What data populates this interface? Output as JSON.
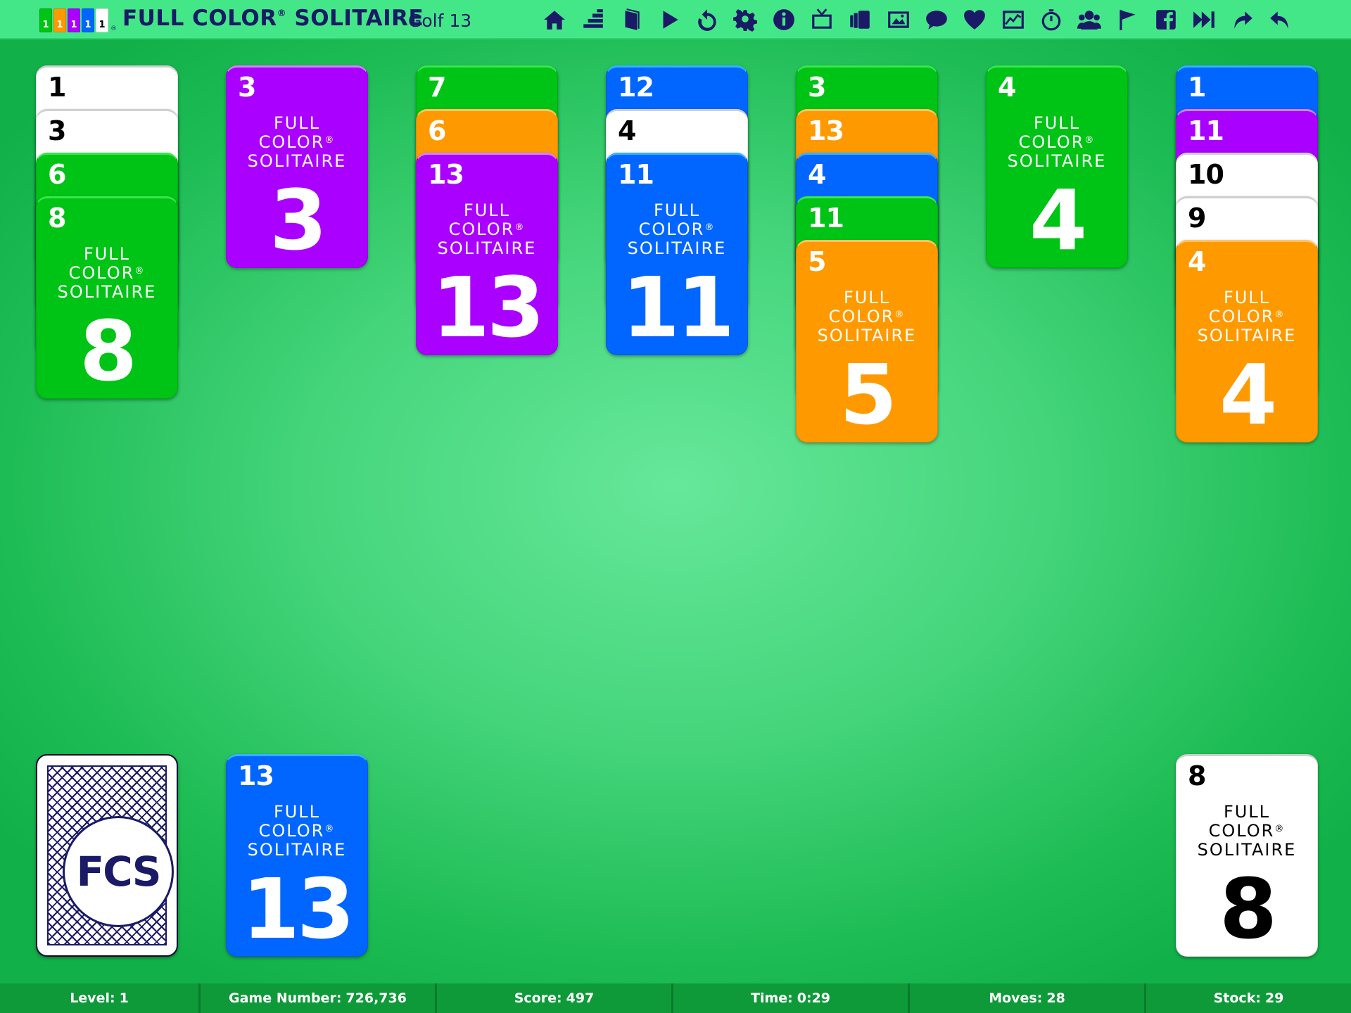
{
  "header": {
    "logo_cards": [
      {
        "label": "1",
        "color": "#00c415"
      },
      {
        "label": "1",
        "color": "#ff9900"
      },
      {
        "label": "1",
        "color": "#aa00ff"
      },
      {
        "label": "1",
        "color": "#0066ff"
      },
      {
        "label": "1",
        "color": "#ffffff"
      }
    ],
    "logo_reg": "®",
    "title": "FULL COLOR",
    "title_reg": "®",
    "title_rest": "SOLITAIRE",
    "subtitle": "Golf 13"
  },
  "toolbar": [
    "home-icon",
    "rank-icon",
    "book-icon",
    "play-icon",
    "restart-icon",
    "settings-icon",
    "info-icon",
    "tv-icon",
    "cards-icon",
    "image-icon",
    "chat-icon",
    "heart-icon",
    "stats-icon",
    "timer-icon",
    "users-icon",
    "flag-icon",
    "facebook-icon",
    "skip-forward-icon",
    "redo-icon",
    "undo-icon"
  ],
  "card_brand": {
    "line1": "FULL",
    "line2": "COLOR",
    "reg": "®",
    "line3": "SOLITAIRE"
  },
  "colors": {
    "blue": "#0066ff",
    "purple": "#aa00ff",
    "green": "#00c415",
    "orange": "#ff9900",
    "white": "#ffffff",
    "navy": "#1a1a66"
  },
  "tableau": [
    [
      {
        "rank": "1",
        "color": "white"
      },
      {
        "rank": "3",
        "color": "white"
      },
      {
        "rank": "6",
        "color": "green"
      },
      {
        "rank": "8",
        "color": "green"
      }
    ],
    [
      {
        "rank": "3",
        "color": "purple"
      }
    ],
    [
      {
        "rank": "7",
        "color": "green"
      },
      {
        "rank": "6",
        "color": "orange"
      },
      {
        "rank": "13",
        "color": "purple"
      }
    ],
    [
      {
        "rank": "12",
        "color": "blue"
      },
      {
        "rank": "4",
        "color": "white"
      },
      {
        "rank": "11",
        "color": "blue"
      }
    ],
    [
      {
        "rank": "3",
        "color": "green"
      },
      {
        "rank": "13",
        "color": "orange"
      },
      {
        "rank": "4",
        "color": "blue"
      },
      {
        "rank": "11",
        "color": "green"
      },
      {
        "rank": "5",
        "color": "orange"
      }
    ],
    [
      {
        "rank": "4",
        "color": "green"
      }
    ],
    [
      {
        "rank": "1",
        "color": "blue"
      },
      {
        "rank": "11",
        "color": "purple"
      },
      {
        "rank": "10",
        "color": "white"
      },
      {
        "rank": "9",
        "color": "white"
      },
      {
        "rank": "4",
        "color": "orange"
      }
    ]
  ],
  "stock_back_text": "FCS",
  "waste": {
    "rank": "13",
    "color": "blue"
  },
  "foundation": {
    "rank": "8",
    "color": "white"
  },
  "status": [
    {
      "label": "Level:",
      "value": "1"
    },
    {
      "label": "Game Number:",
      "value": "726,736"
    },
    {
      "label": "Score:",
      "value": "497"
    },
    {
      "label": "Time:",
      "value": "0:29"
    },
    {
      "label": "Moves:",
      "value": "28"
    },
    {
      "label": "Stock:",
      "value": "29"
    }
  ]
}
